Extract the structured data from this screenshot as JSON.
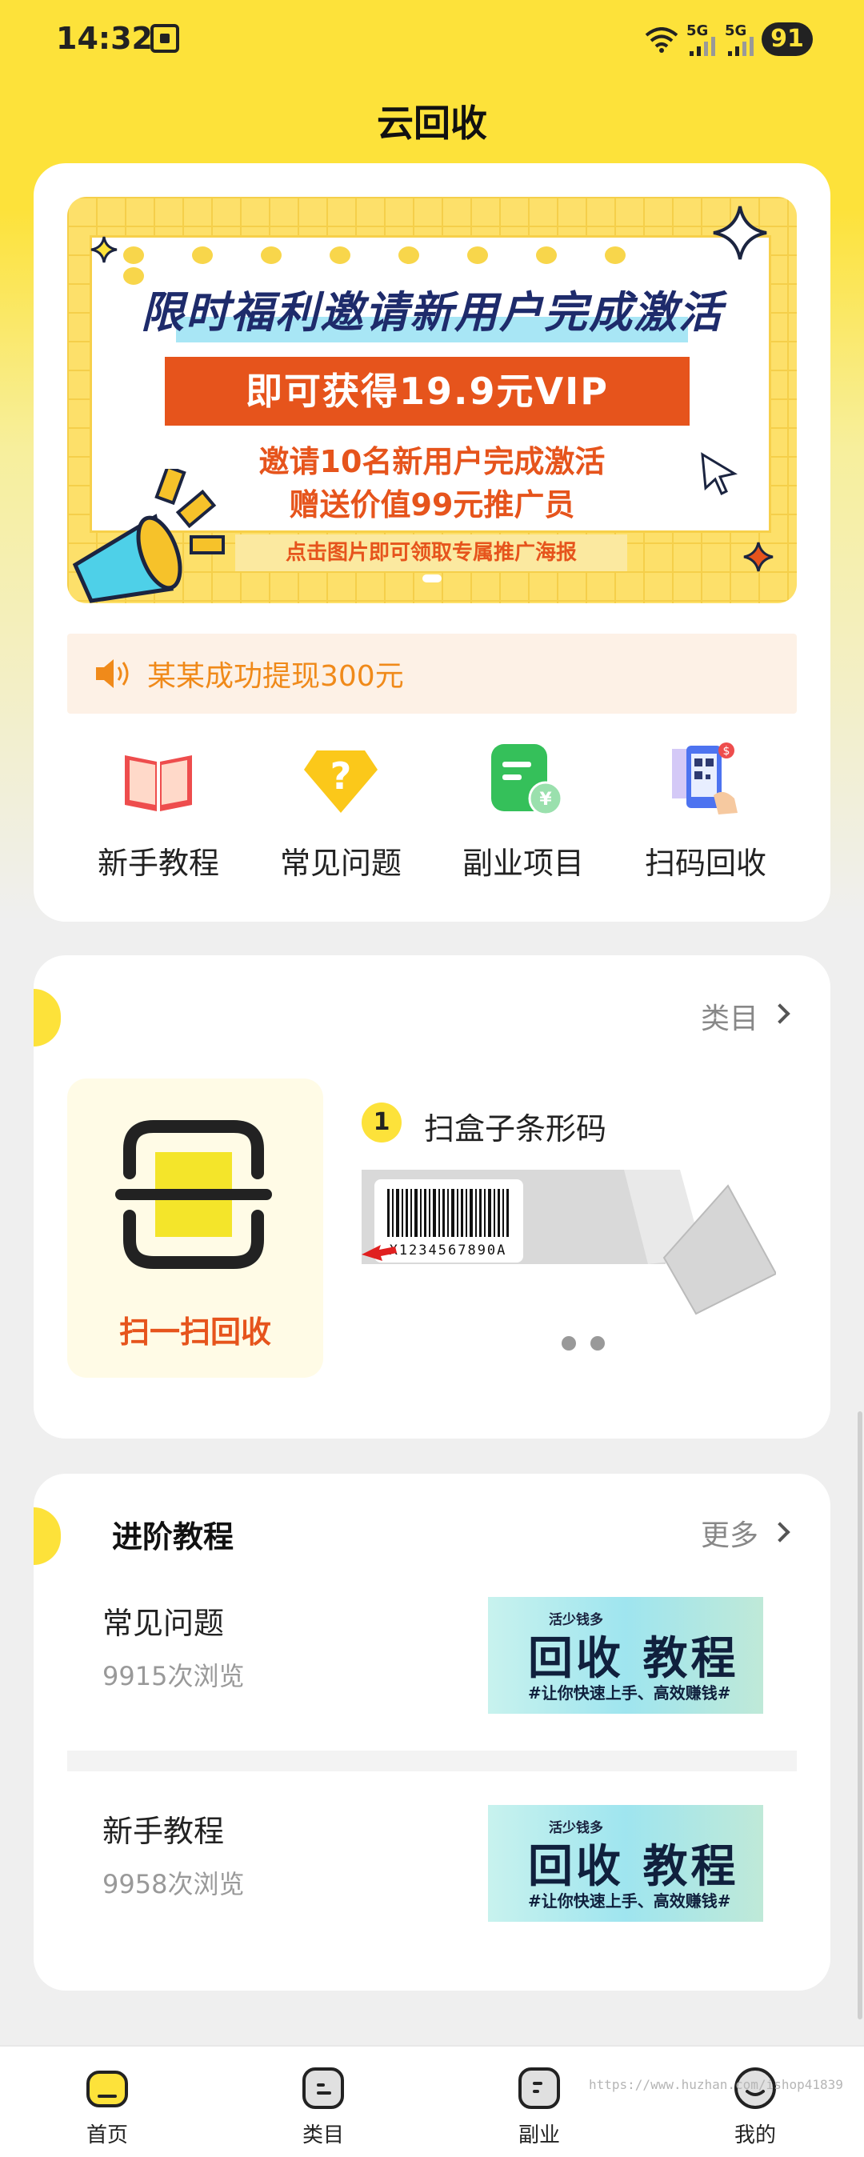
{
  "status_bar": {
    "time": "14:32",
    "battery": "91",
    "sig1": "5G",
    "sig2": "5G"
  },
  "header": {
    "title": "云回收"
  },
  "banner": {
    "line1": "限时福利邀请新用户完成激活",
    "button": "即可获得19.9元VIP",
    "line3": "邀请10名新用户完成激活",
    "line4": "赠送价值99元推广员",
    "footer": "点击图片即可领取专属推广海报"
  },
  "notice": {
    "text": "某某成功提现300元"
  },
  "quick_links": [
    {
      "label": "新手教程",
      "icon": "open-book-icon"
    },
    {
      "label": "常见问题",
      "icon": "question-diamond-icon"
    },
    {
      "label": "副业项目",
      "icon": "money-note-icon"
    },
    {
      "label": "扫码回收",
      "icon": "phone-qr-icon"
    }
  ],
  "category": {
    "link": "类目",
    "scan_label": "扫一扫回收",
    "step_number": "1",
    "step_text": "扫盒子条形码",
    "barcode_text": "X1234567890A"
  },
  "advanced": {
    "title": "进阶教程",
    "more": "更多",
    "articles": [
      {
        "title": "常见问题",
        "views": "9915次浏览"
      },
      {
        "title": "新手教程",
        "views": "9958次浏览"
      }
    ],
    "thumb": {
      "small": "活少钱多",
      "big": "回收 教程",
      "sub": "#让你快速上手、高效赚钱#"
    }
  },
  "nav": {
    "items": [
      {
        "label": "首页"
      },
      {
        "label": "类目"
      },
      {
        "label": "副业"
      },
      {
        "label": "我的"
      }
    ]
  },
  "watermark": "https://www.huzhan.com/ishop41839",
  "colors": {
    "brand_yellow": "#fde23a",
    "accent_orange": "#e6541c"
  }
}
